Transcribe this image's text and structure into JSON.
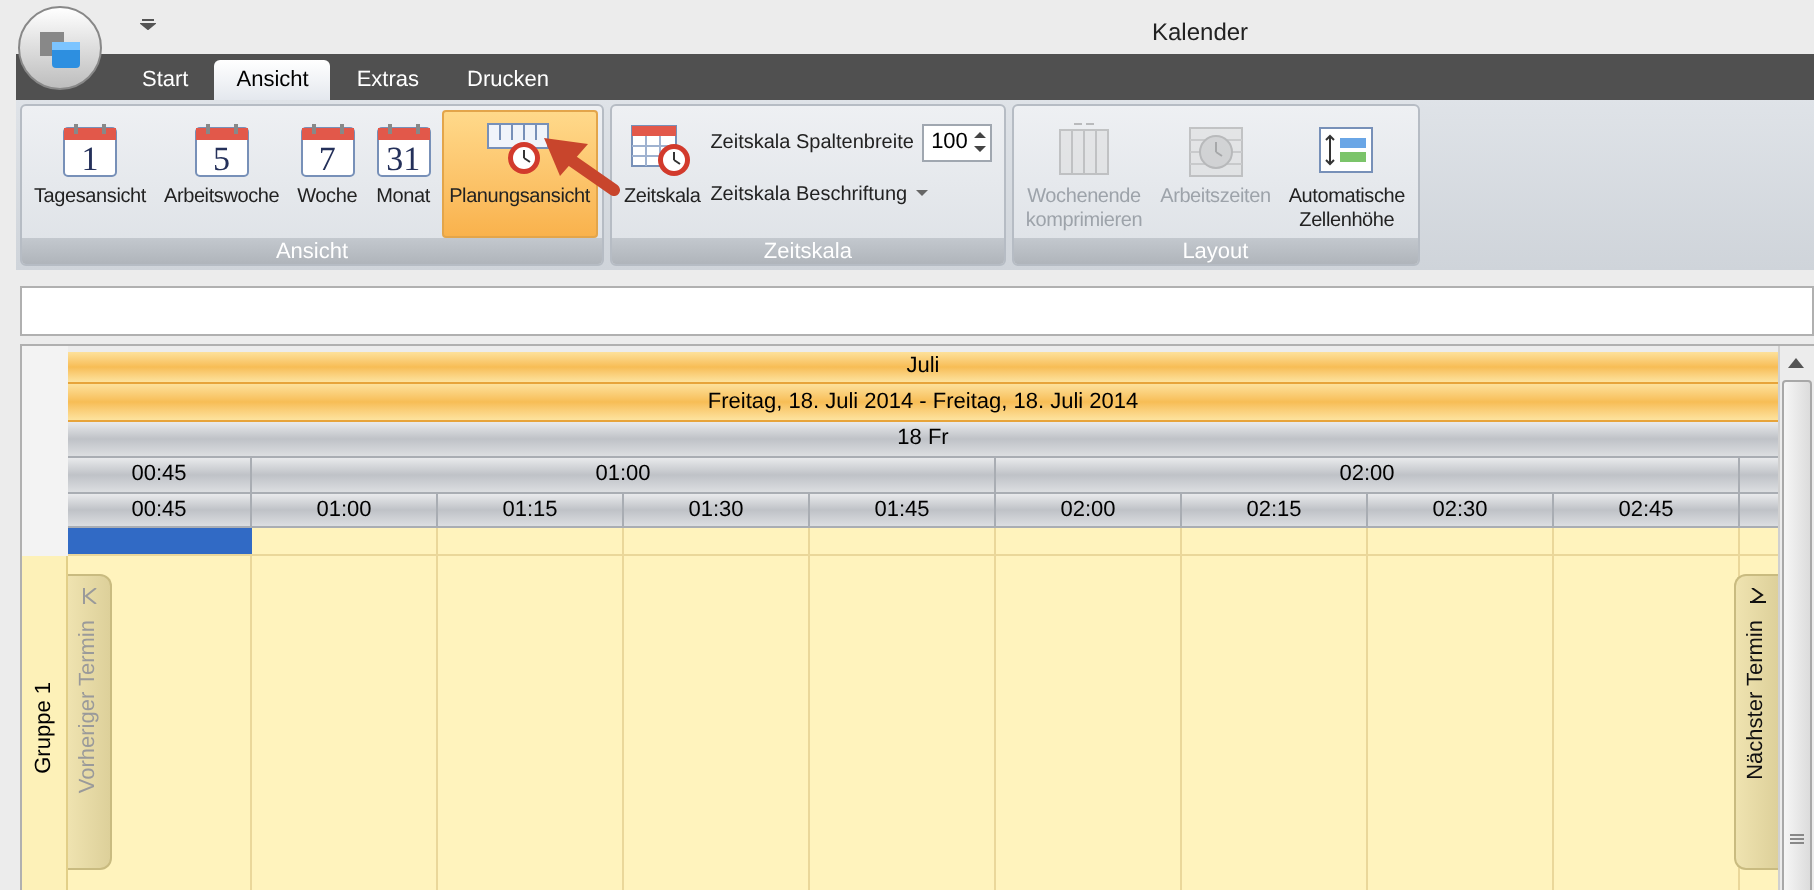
{
  "window": {
    "title": "Kalender"
  },
  "ribbon_tabs": [
    {
      "label": "Start",
      "selected": false
    },
    {
      "label": "Ansicht",
      "selected": true
    },
    {
      "label": "Extras",
      "selected": false
    },
    {
      "label": "Drucken",
      "selected": false
    }
  ],
  "ribbon_groups": [
    {
      "caption": "Ansicht",
      "items": [
        {
          "kind": "calendar",
          "label": "Tagesansicht",
          "icon_text": "1",
          "selected": false,
          "disabled": false
        },
        {
          "kind": "calendar",
          "label": "Arbeitswoche",
          "icon_text": "5",
          "selected": false,
          "disabled": false
        },
        {
          "kind": "calendar",
          "label": "Woche",
          "icon_text": "7",
          "selected": false,
          "disabled": false
        },
        {
          "kind": "calendar",
          "label": "Monat",
          "icon_text": "31",
          "selected": false,
          "disabled": false
        },
        {
          "kind": "planner",
          "label": "Planungsansicht",
          "selected": true,
          "disabled": false
        }
      ]
    },
    {
      "caption": "Zeitskala",
      "items": [
        {
          "kind": "timescale",
          "label": "Zeitskala",
          "selected": false,
          "disabled": false
        }
      ],
      "small_items": [
        {
          "kind": "spinner",
          "label": "Zeitskala Spaltenbreite",
          "value": "100"
        },
        {
          "kind": "dropdown",
          "label": "Zeitskala Beschriftung"
        }
      ]
    },
    {
      "caption": "Layout",
      "items": [
        {
          "kind": "compress",
          "label": "Wochenende\nkomprimieren",
          "selected": false,
          "disabled": true
        },
        {
          "kind": "worktime",
          "label": "Arbeitszeiten",
          "selected": false,
          "disabled": true
        },
        {
          "kind": "rowheight",
          "label": "Automatische\nZellenhöhe",
          "selected": false,
          "disabled": false
        }
      ]
    }
  ],
  "scheduler": {
    "month": "Juli",
    "date_range": "Freitag, 18. Juli 2014 - Freitag, 18. Juli 2014",
    "day": "18 Fr",
    "hours": [
      {
        "label": "00:45",
        "slots": [
          {
            "label": "00:45",
            "selected": true
          }
        ]
      },
      {
        "label": "01:00",
        "slots": [
          {
            "label": "01:00",
            "selected": false
          },
          {
            "label": "01:15",
            "selected": false
          },
          {
            "label": "01:30",
            "selected": false
          },
          {
            "label": "01:45",
            "selected": false
          }
        ]
      },
      {
        "label": "02:00",
        "slots": [
          {
            "label": "02:00",
            "selected": false
          },
          {
            "label": "02:15",
            "selected": false
          },
          {
            "label": "02:30",
            "selected": false
          },
          {
            "label": "02:45",
            "selected": false
          }
        ]
      }
    ],
    "groups": [
      {
        "label": "Gruppe 1"
      }
    ],
    "prev_button": {
      "label": "Vorheriger Termin",
      "disabled": true
    },
    "next_button": {
      "label": "Nächster Termin",
      "disabled": false
    }
  }
}
